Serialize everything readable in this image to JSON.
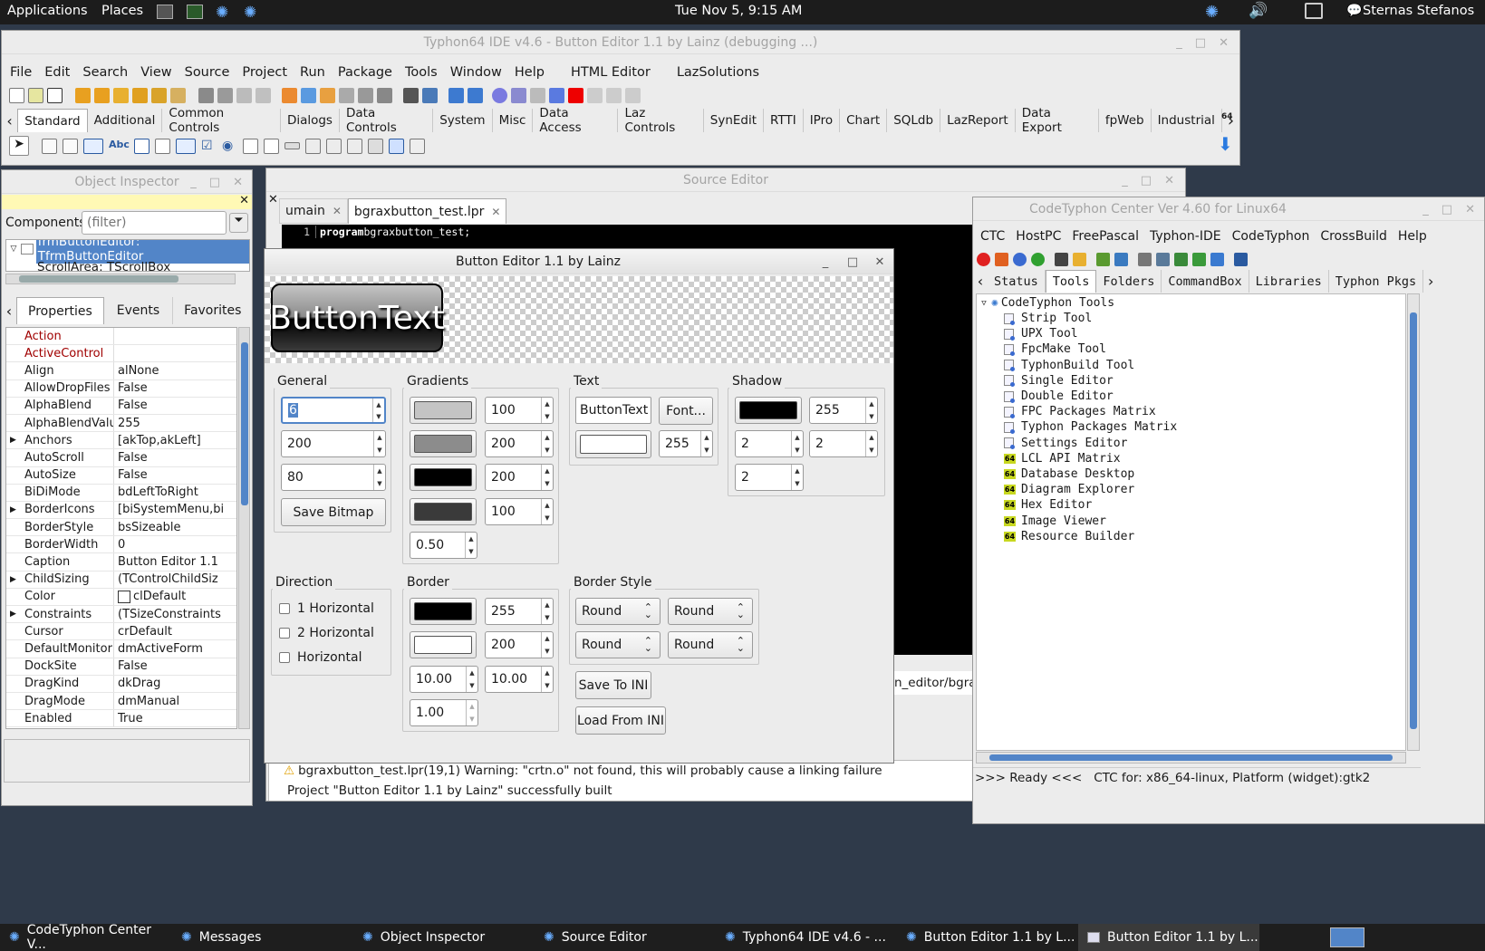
{
  "topbar": {
    "applications": "Applications",
    "places": "Places",
    "clock": "Tue Nov  5,  9:15 AM",
    "user": "Sternas Stefanos"
  },
  "ide": {
    "title": "Typhon64 IDE v4.6 - Button Editor 1.1 by Lainz (debugging ...)",
    "menus": [
      "File",
      "Edit",
      "Search",
      "View",
      "Source",
      "Project",
      "Run",
      "Package",
      "Tools",
      "Window",
      "Help",
      "HTML Editor",
      "LazSolutions"
    ],
    "palette_tabs": [
      "Standard",
      "Additional",
      "Common Controls",
      "Dialogs",
      "Data Controls",
      "System",
      "Misc",
      "Data Access",
      "Laz Controls",
      "SynEdit",
      "RTTI",
      "IPro",
      "Chart",
      "SQLdb",
      "LazReport",
      "Data Export",
      "fpWeb",
      "Industrial"
    ],
    "palette_badge": "64"
  },
  "inspector": {
    "title": "Object Inspector",
    "components_label": "Components",
    "filter_placeholder": "(filter)",
    "tree_root": "frmButtonEditor: TfrmButtonEditor",
    "tree_child": "ScrollArea: TScrollBox",
    "tabs": [
      "Properties",
      "Events",
      "Favorites"
    ],
    "props": [
      {
        "k": "Action",
        "v": ""
      },
      {
        "k": "ActiveControl",
        "v": ""
      },
      {
        "k": "Align",
        "v": "alNone"
      },
      {
        "k": "AllowDropFiles",
        "v": "False"
      },
      {
        "k": "AlphaBlend",
        "v": "False"
      },
      {
        "k": "AlphaBlendValue",
        "v": "255"
      },
      {
        "k": "Anchors",
        "v": "[akTop,akLeft]"
      },
      {
        "k": "AutoScroll",
        "v": "False"
      },
      {
        "k": "AutoSize",
        "v": "False"
      },
      {
        "k": "BiDiMode",
        "v": "bdLeftToRight"
      },
      {
        "k": "BorderIcons",
        "v": "[biSystemMenu,bi"
      },
      {
        "k": "BorderStyle",
        "v": "bsSizeable"
      },
      {
        "k": "BorderWidth",
        "v": "0"
      },
      {
        "k": "Caption",
        "v": "Button Editor 1.1"
      },
      {
        "k": "ChildSizing",
        "v": "(TControlChildSiz"
      },
      {
        "k": "Color",
        "v": "clDefault"
      },
      {
        "k": "Constraints",
        "v": "(TSizeConstraints"
      },
      {
        "k": "Cursor",
        "v": "crDefault"
      },
      {
        "k": "DefaultMonitor",
        "v": "dmActiveForm"
      },
      {
        "k": "DockSite",
        "v": "False"
      },
      {
        "k": "DragKind",
        "v": "dkDrag"
      },
      {
        "k": "DragMode",
        "v": "dmManual"
      },
      {
        "k": "Enabled",
        "v": "True"
      }
    ]
  },
  "source": {
    "title": "Source Editor",
    "tabs": [
      "umain",
      "bgraxbutton_test.lpr"
    ],
    "line_no": "1",
    "code_kw": "program",
    "code_rest": " bgraxbutton_test;",
    "path_fragment": "n_editor/bgra"
  },
  "messages": {
    "warning": "bgraxbutton_test.lpr(19,1) Warning: \"crtn.o\" not found, this will probably cause a linking failure",
    "built": "Project \"Button Editor 1.1 by Lainz\" successfully built"
  },
  "editor": {
    "title": "Button Editor 1.1 by Lainz",
    "preview_text": "ButtonText",
    "general": {
      "label": "General",
      "v1": "6",
      "v2": "200",
      "v3": "80",
      "save_bitmap": "Save Bitmap"
    },
    "gradients": {
      "label": "Gradients",
      "v1": "100",
      "v2": "200",
      "v3": "200",
      "v4": "100",
      "v5": "0.50",
      "c1": "#c4c4c4",
      "c2": "#8c8c8c",
      "c3": "#000000",
      "c4": "#3a3a3a"
    },
    "text": {
      "label": "Text",
      "field": "ButtonText",
      "font_button": "Font...",
      "alpha": "255"
    },
    "shadow": {
      "label": "Shadow",
      "v1": "255",
      "v2": "2",
      "v3": "2",
      "v4": "2"
    },
    "direction": {
      "label": "Direction",
      "o1": "1 Horizontal",
      "o2": "2 Horizontal",
      "o3": "Horizontal"
    },
    "border": {
      "label": "Border",
      "v1": "255",
      "v2": "200",
      "v3": "10.00",
      "v4": "10.00",
      "v5": "1.00"
    },
    "border_style": {
      "label": "Border Style",
      "s1": "Round",
      "s2": "Round",
      "s3": "Round",
      "s4": "Round"
    },
    "save_ini": "Save To INI",
    "load_ini": "Load From INI"
  },
  "ctc": {
    "title": "CodeTyphon Center Ver 4.60 for Linux64",
    "menus": [
      "CTC",
      "HostPC",
      "FreePascal",
      "Typhon-IDE",
      "CodeTyphon",
      "CrossBuild",
      "Help"
    ],
    "tabs": [
      "Status",
      "Tools",
      "Folders",
      "CommandBox",
      "Libraries",
      "Typhon Pkgs"
    ],
    "tree_root": "CodeTyphon Tools",
    "items": [
      {
        "label": "Strip Tool",
        "icon": "tool"
      },
      {
        "label": "UPX Tool",
        "icon": "tool"
      },
      {
        "label": "FpcMake Tool",
        "icon": "tool"
      },
      {
        "label": "TyphonBuild Tool",
        "icon": "tool"
      },
      {
        "label": "Single Editor",
        "icon": "tool"
      },
      {
        "label": "Double Editor",
        "icon": "tool"
      },
      {
        "label": "FPC Packages Matrix",
        "icon": "tool"
      },
      {
        "label": "Typhon Packages Matrix",
        "icon": "tool"
      },
      {
        "label": "Settings Editor",
        "icon": "tool"
      },
      {
        "label": "LCL API Matrix",
        "icon": "64"
      },
      {
        "label": "Database Desktop",
        "icon": "64"
      },
      {
        "label": "Diagram Explorer",
        "icon": "64"
      },
      {
        "label": "Hex Editor",
        "icon": "64"
      },
      {
        "label": "Image Viewer",
        "icon": "64"
      },
      {
        "label": "Resource Builder",
        "icon": "64"
      }
    ],
    "badge64": "64",
    "status": ">>> Ready <<<   CTC for: x86_64-linux, Platform (widget):gtk2"
  },
  "taskbar": [
    "CodeTyphon Center V...",
    "Messages",
    "Object Inspector",
    "Source Editor",
    "Typhon64 IDE v4.6 - ...",
    "Button Editor 1.1 by L...",
    "Button Editor 1.1 by L..."
  ]
}
